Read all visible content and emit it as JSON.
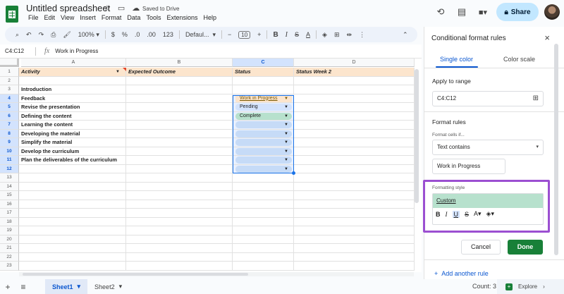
{
  "app": {
    "doc_title": "Untitled spreadsheet",
    "saved_status": "Saved to Drive",
    "menu": [
      "File",
      "Edit",
      "View",
      "Insert",
      "Format",
      "Data",
      "Tools",
      "Extensions",
      "Help"
    ],
    "share_label": "Share"
  },
  "toolbar": {
    "zoom": "100%",
    "currency": "$",
    "percent": "%",
    "dec_decrease": ".0",
    "dec_increase": ".00",
    "number_format": "123",
    "font": "Defaul...",
    "font_size": "10",
    "bold": "B",
    "italic": "I",
    "strike": "S",
    "text_color": "A",
    "minus": "−",
    "plus": "+"
  },
  "formula_bar": {
    "name_box": "C4:C12",
    "fx": "fx",
    "content": "Work in Progress"
  },
  "grid": {
    "columns": [
      "A",
      "B",
      "C",
      "D"
    ],
    "row_numbers": [
      "1",
      "2",
      "3",
      "4",
      "5",
      "6",
      "7",
      "8",
      "9",
      "10",
      "11",
      "12",
      "13",
      "14",
      "15",
      "16",
      "17",
      "18",
      "19",
      "20",
      "21",
      "22",
      "23"
    ],
    "header": {
      "activity": "Activity",
      "expected": "Expected Outcome",
      "status": "Status",
      "status_week2": "Status Week 2"
    },
    "col_a": [
      "",
      "",
      "Introduction",
      "Feedback",
      "Revise the presentation",
      "Defining the content",
      "Learning the content",
      "Developing the material",
      "Simplify the material",
      "Develop the curriculum",
      "Plan the deliverables of the curriculum"
    ],
    "status_chips": [
      "Work in Progress",
      "Pending",
      "Complete",
      "",
      "",
      "",
      "",
      "",
      ""
    ]
  },
  "sheets": {
    "tabs": [
      "Sheet1",
      "Sheet2"
    ],
    "count": "Count: 3",
    "explore": "Explore"
  },
  "panel": {
    "title": "Conditional format rules",
    "tab_single": "Single color",
    "tab_scale": "Color scale",
    "apply_label": "Apply to range",
    "range": "C4:C12",
    "rules_label": "Format rules",
    "cells_if_label": "Format cells if...",
    "condition": "Text contains",
    "value": "Work in Progress",
    "style_label": "Formatting style",
    "style_name": "Custom",
    "cancel": "Cancel",
    "done": "Done",
    "add_rule": "Add another rule"
  },
  "colors": {
    "highlight_box": "#9b4fd1",
    "custom_fill": "#b7e1cd",
    "done_button": "#188038",
    "header_fill": "#fce5cd",
    "share_button": "#c2e7ff"
  }
}
